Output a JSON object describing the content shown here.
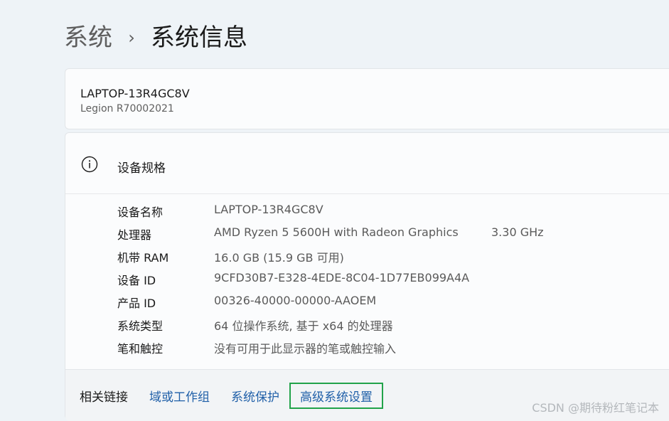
{
  "breadcrumb": {
    "parent": "系统",
    "separator": "›",
    "current": "系统信息"
  },
  "device": {
    "name": "LAPTOP-13R4GC8V",
    "model": "Legion R70002021"
  },
  "specs": {
    "title": "设备规格",
    "icon": "info-icon",
    "rows": [
      {
        "label": "设备名称",
        "value": "LAPTOP-13R4GC8V",
        "extra": ""
      },
      {
        "label": "处理器",
        "value": "AMD Ryzen 5 5600H with Radeon Graphics",
        "extra": "3.30 GHz"
      },
      {
        "label": "机带 RAM",
        "value": "16.0 GB (15.9 GB 可用)",
        "extra": ""
      },
      {
        "label": "设备 ID",
        "value": "9CFD30B7-E328-4EDE-8C04-1D77EB099A4A",
        "extra": ""
      },
      {
        "label": "产品 ID",
        "value": "00326-40000-00000-AAOEM",
        "extra": ""
      },
      {
        "label": "系统类型",
        "value": "64 位操作系统, 基于 x64 的处理器",
        "extra": ""
      },
      {
        "label": "笔和触控",
        "value": "没有可用于此显示器的笔或触控输入",
        "extra": ""
      }
    ]
  },
  "related_links": {
    "label": "相关链接",
    "links": [
      "域或工作组",
      "系统保护",
      "高级系统设置"
    ],
    "highlight_color": "#22a34a",
    "link_color": "#1f5fa8"
  },
  "watermark": "CSDN @期待粉红笔记本"
}
